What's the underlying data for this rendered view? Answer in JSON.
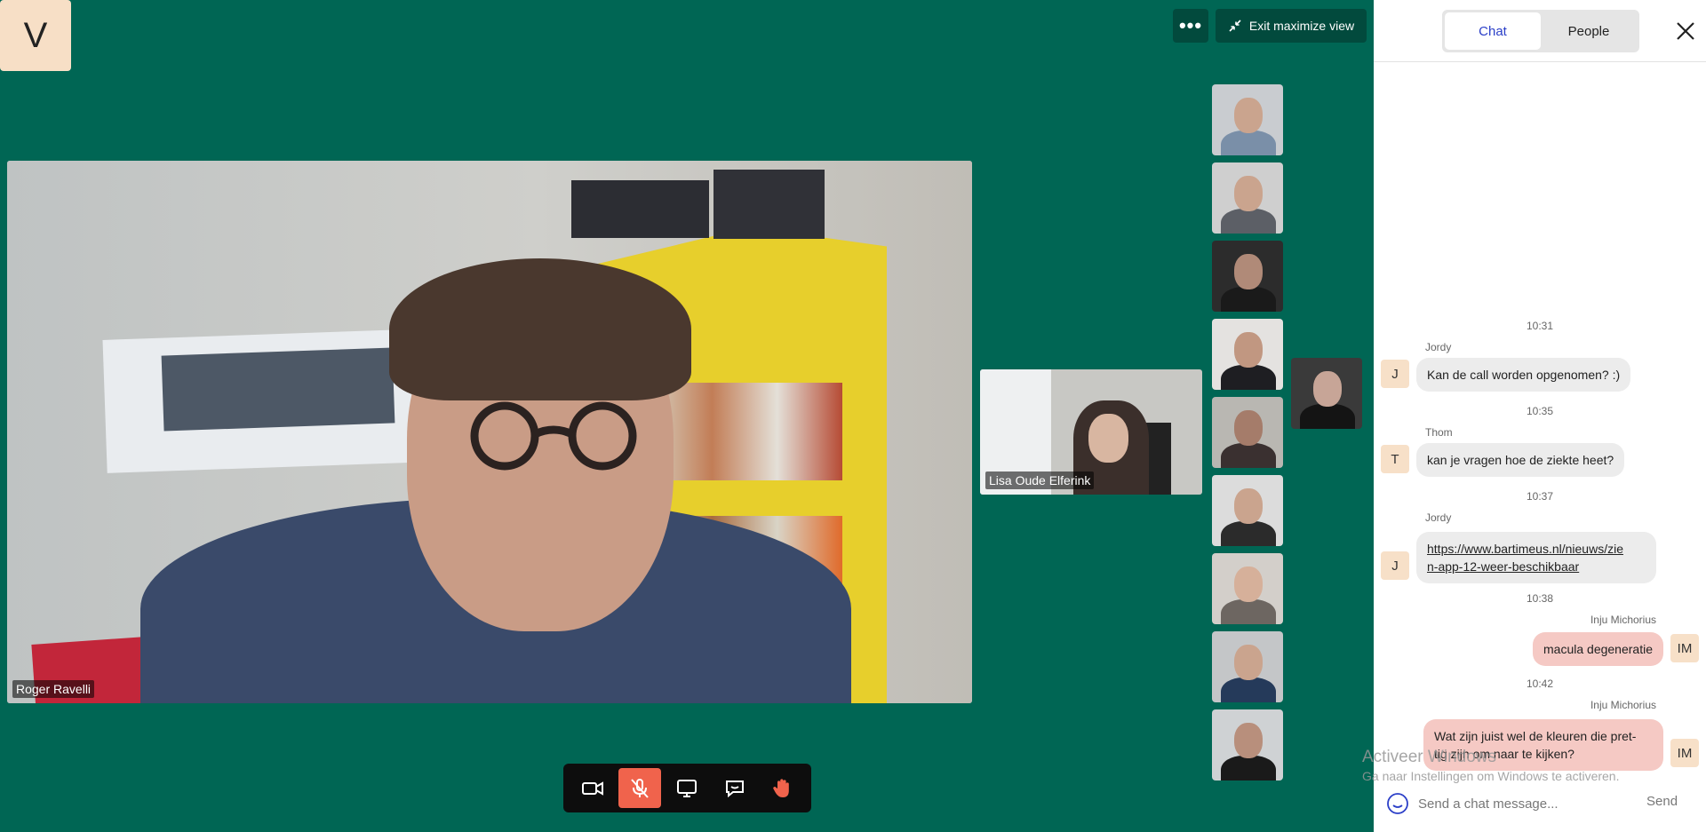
{
  "top_bar": {
    "more_label": "•••",
    "exit_maximize_label": "Exit maximize view"
  },
  "main_video": {
    "participant": "Roger Ravelli"
  },
  "secondary_video": {
    "participant": "Lisa Oude Elferink"
  },
  "thumbnail_initial": "V",
  "controls": [
    "camera-icon",
    "microphone-muted-icon",
    "screen-share-icon",
    "chat-icon",
    "raise-hand-icon"
  ],
  "colors": {
    "stage": "#006654",
    "mic_off": "#f0634c",
    "own_bubble": "#f5c9c4",
    "other_bubble": "#ececec",
    "active_tab_text": "#2b3fc8"
  },
  "chat": {
    "tabs": [
      "Chat",
      "People"
    ],
    "active_tab": "Chat",
    "messages": [
      {
        "time": "10:31",
        "sender": "Jordy",
        "initial": "J",
        "text": "Kan de call worden opgenomen? :)"
      },
      {
        "time": "10:35",
        "sender": "Thom",
        "initial": "T",
        "text": "kan je vragen hoe de ziekte heet?"
      },
      {
        "time": "10:37",
        "sender": "Jordy",
        "initial": "J",
        "link_line1": "https://www.bartimeus.nl/nieuws/zie",
        "link_line2": "n-app-12-weer-beschikbaar"
      },
      {
        "time": "10:38",
        "sender": "Inju Michorius",
        "initial": "IM",
        "text": "macula degeneratie"
      },
      {
        "time": "10:42",
        "sender": "Inju Michorius",
        "initial": "IM",
        "text_line1": "Wat zijn juist wel de kleuren die pret-",
        "text_line2": "tig zijn om naar te kijken?"
      }
    ],
    "input_placeholder": "Send a chat message...",
    "send_label": "Send"
  },
  "watermark": {
    "title": "Activeer Windows",
    "subtitle": "Ga naar Instellingen om Windows te activeren."
  }
}
